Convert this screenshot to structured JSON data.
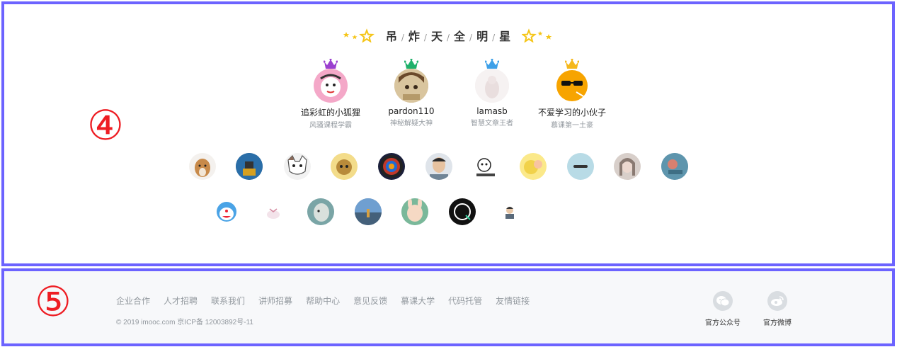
{
  "badges": {
    "section4": "④",
    "section5": "⑤"
  },
  "title": {
    "chars": [
      "吊",
      "炸",
      "天",
      "全",
      "明",
      "星"
    ],
    "separator": "/"
  },
  "top_stars": [
    {
      "name": "追彩虹的小狐狸",
      "title": "风骚课程学霸",
      "crown_color": "#9b3fcf",
      "avatar_color": "#f4a8c8"
    },
    {
      "name": "pardon110",
      "title": "神秘解疑大神",
      "crown_color": "#1fb06b",
      "avatar_color": "#c8b18c"
    },
    {
      "name": "lamasb",
      "title": "智慧文章王者",
      "crown_color": "#3ea0e8",
      "avatar_color": "#f1eded"
    },
    {
      "name": "不爱学习的小伙子",
      "title": "慕课第一土豪",
      "crown_color": "#f5b81c",
      "avatar_color": "#f7a400"
    }
  ],
  "avatars_row1": [
    "#c88a4a",
    "#1e5a8a",
    "#e8e8e8",
    "#b88a3a",
    "#1b1f3a",
    "#6f8496",
    "#f2f2f2",
    "#f1d24a",
    "#b8dbe6",
    "#c8b8b0",
    "#6aa1b8"
  ],
  "avatars_row2": [
    "#4aa3e6",
    "#f6f6f6",
    "#8fb7b8",
    "#5a7ea8",
    "#7ab89a",
    "#111111",
    "#f2f2f2"
  ],
  "footer": {
    "links": [
      "企业合作",
      "人才招聘",
      "联系我们",
      "讲师招募",
      "帮助中心",
      "意见反馈",
      "慕课大学",
      "代码托管",
      "友情链接"
    ],
    "copyright": "© 2019 imooc.com  京ICP备 12003892号-11",
    "social": [
      {
        "label": "官方公众号",
        "icon": "wechat-icon"
      },
      {
        "label": "官方微博",
        "icon": "weibo-icon"
      }
    ]
  }
}
